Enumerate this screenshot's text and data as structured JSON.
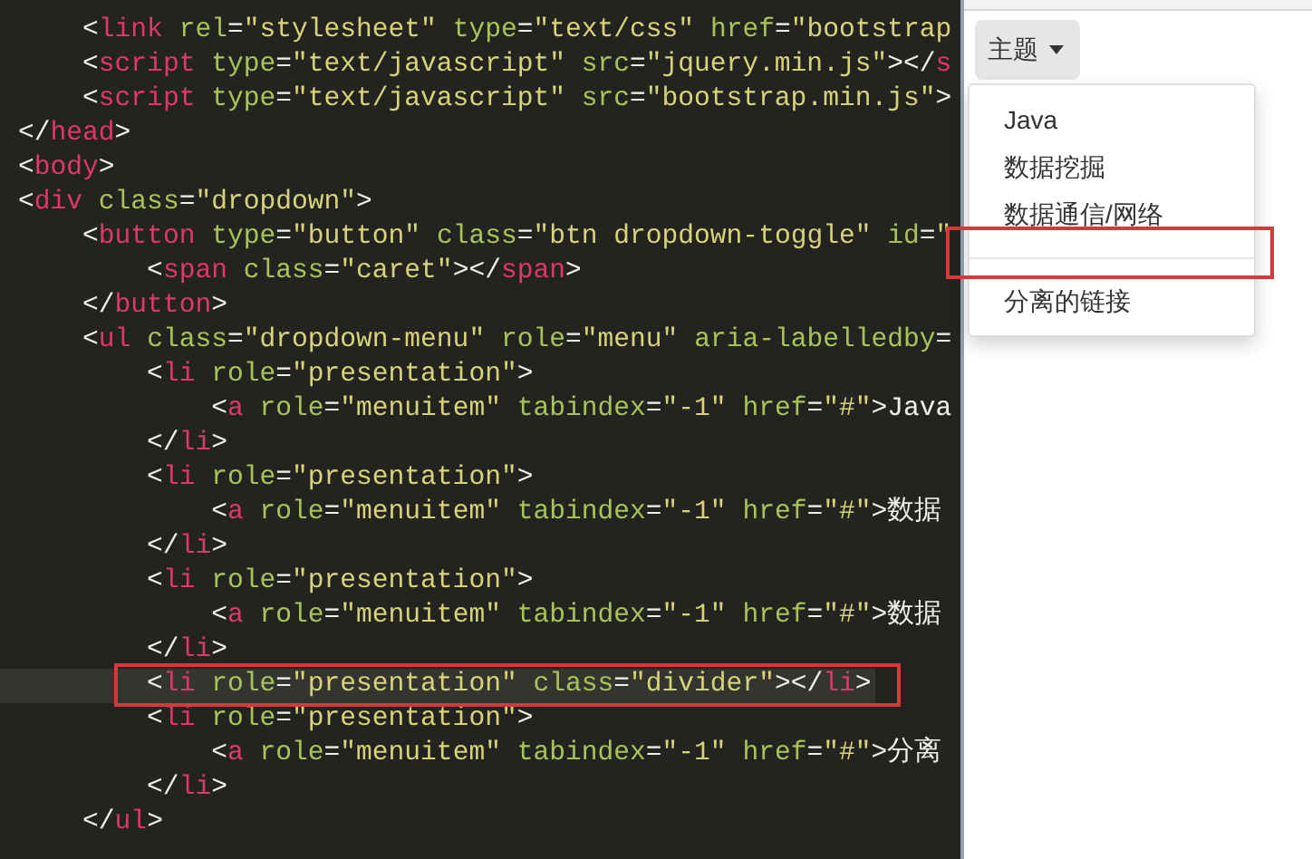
{
  "editor": {
    "lines": [
      {
        "code": "    <link rel=\"stylesheet\" type=\"text/css\" href=\"bootstrap",
        "current": false
      },
      {
        "code": "    <script type=\"text/javascript\" src=\"jquery.min.js\"></s",
        "current": false
      },
      {
        "code": "    <script type=\"text/javascript\" src=\"bootstrap.min.js\">",
        "current": false
      },
      {
        "code": "</head>",
        "current": false
      },
      {
        "code": "<body>",
        "current": false
      },
      {
        "code": "<div class=\"dropdown\">",
        "current": false
      },
      {
        "code": "    <button type=\"button\" class=\"btn dropdown-toggle\" id=\"",
        "current": false
      },
      {
        "code": "        <span class=\"caret\"></span>",
        "current": false
      },
      {
        "code": "    </button>",
        "current": false
      },
      {
        "code": "    <ul class=\"dropdown-menu\" role=\"menu\" aria-labelledby=",
        "current": false
      },
      {
        "code": "        <li role=\"presentation\">",
        "current": false
      },
      {
        "code": "            <a role=\"menuitem\" tabindex=\"-1\" href=\"#\">Java",
        "current": false
      },
      {
        "code": "        </li>",
        "current": false
      },
      {
        "code": "        <li role=\"presentation\">",
        "current": false
      },
      {
        "code": "            <a role=\"menuitem\" tabindex=\"-1\" href=\"#\">数据",
        "current": false
      },
      {
        "code": "        </li>",
        "current": false
      },
      {
        "code": "        <li role=\"presentation\">",
        "current": false
      },
      {
        "code": "            <a role=\"menuitem\" tabindex=\"-1\" href=\"#\">数据",
        "current": false
      },
      {
        "code": "        </li>",
        "current": false
      },
      {
        "code": "        <li role=\"presentation\" class=\"divider\"></li>",
        "current": true
      },
      {
        "code": "        <li role=\"presentation\">",
        "current": false
      },
      {
        "code": "            <a role=\"menuitem\" tabindex=\"-1\" href=\"#\">分离",
        "current": false
      },
      {
        "code": "        </li>",
        "current": false
      },
      {
        "code": "    </ul>",
        "current": false
      }
    ]
  },
  "preview": {
    "dropdown": {
      "label": "主题",
      "open": true,
      "items": [
        {
          "kind": "link",
          "label": "Java"
        },
        {
          "kind": "link",
          "label": "数据挖掘"
        },
        {
          "kind": "link",
          "label": "数据通信/网络"
        },
        {
          "kind": "divider"
        },
        {
          "kind": "link",
          "label": "分离的链接"
        }
      ]
    }
  }
}
